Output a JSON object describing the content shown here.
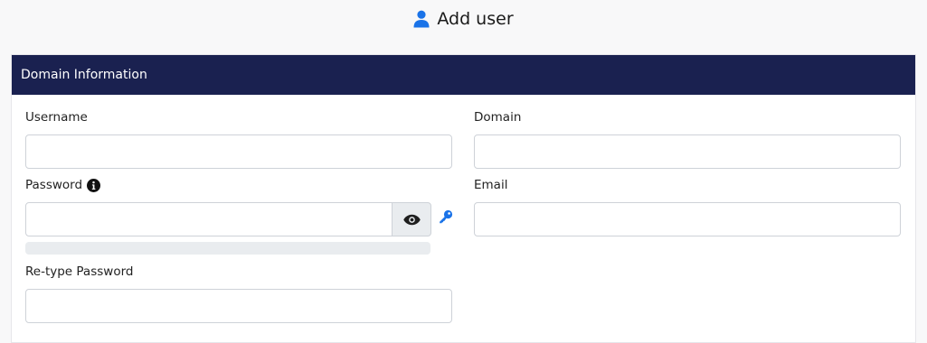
{
  "page": {
    "title": "Add user"
  },
  "card": {
    "title": "Domain Information"
  },
  "form": {
    "username": {
      "label": "Username",
      "value": ""
    },
    "domain": {
      "label": "Domain",
      "value": ""
    },
    "password": {
      "label": "Password",
      "value": "",
      "strength": 0
    },
    "email": {
      "label": "Email",
      "value": ""
    },
    "retype_password": {
      "label": "Re-type Password",
      "value": ""
    }
  },
  "icons": {
    "title": "user-icon",
    "password_info": "info-icon",
    "show_password": "eye-icon",
    "generate_password": "key-icon"
  },
  "colors": {
    "accent": "#1a73e8",
    "header_bg": "#1a2150",
    "header_text": "#ffffff",
    "page_bg": "#f8f8f9"
  }
}
